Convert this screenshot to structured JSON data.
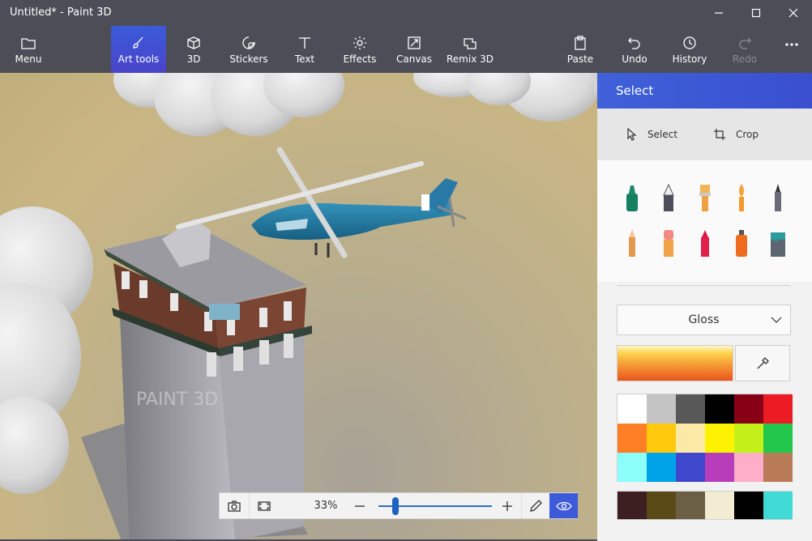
{
  "window": {
    "title": "Untitled* - Paint 3D"
  },
  "toolbar": {
    "items": [
      {
        "label": "Menu",
        "icon": "folder-icon",
        "active": false
      },
      {
        "label": "Art tools",
        "icon": "brush-icon",
        "active": true
      },
      {
        "label": "3D",
        "icon": "cube-icon",
        "active": false
      },
      {
        "label": "Stickers",
        "icon": "sticker-icon",
        "active": false
      },
      {
        "label": "Text",
        "icon": "text-icon",
        "active": false
      },
      {
        "label": "Effects",
        "icon": "sun-icon",
        "active": false
      },
      {
        "label": "Canvas",
        "icon": "canvas-resize-icon",
        "active": false
      },
      {
        "label": "Remix 3D",
        "icon": "remix-icon",
        "active": false
      },
      {
        "label": "Paste",
        "icon": "clipboard-icon",
        "active": false
      },
      {
        "label": "Undo",
        "icon": "undo-icon",
        "active": false
      },
      {
        "label": "History",
        "icon": "history-icon",
        "active": false
      },
      {
        "label": "Redo",
        "icon": "redo-icon",
        "active": false,
        "disabled": true
      }
    ],
    "more": "more-icon"
  },
  "zoom": {
    "level_text": "33%",
    "slider_value": 0.15
  },
  "panel": {
    "title": "Select",
    "select_label": "Select",
    "crop_label": "Crop",
    "brushes": [
      {
        "name": "marker-brush",
        "color": "#1a8a6a"
      },
      {
        "name": "calligraphy-pen",
        "color": "#5a5a6a"
      },
      {
        "name": "oil-brush",
        "color": "#e9a24a"
      },
      {
        "name": "watercolor-brush",
        "color": "#f0a030"
      },
      {
        "name": "pixel-pen",
        "color": "#6a6a7a"
      },
      {
        "name": "pencil",
        "color": "#e0a060"
      },
      {
        "name": "eraser",
        "color": "#f08a80"
      },
      {
        "name": "crayon",
        "color": "#e0204a"
      },
      {
        "name": "spray-can",
        "color": "#f06a20"
      },
      {
        "name": "fill-bucket",
        "color": "#2a9a9a"
      }
    ],
    "texture": "Gloss",
    "current_color": "#f27a2a",
    "palette": [
      "#ffffff",
      "#c3c3c3",
      "#585858",
      "#000000",
      "#880015",
      "#ed1c24",
      "#ff7f27",
      "#ffc90e",
      "#fce9a5",
      "#fff200",
      "#c4f019",
      "#22c74c",
      "#8cfffb",
      "#00a2e8",
      "#3f48cc",
      "#b83dba",
      "#ffaec9",
      "#b97a57"
    ],
    "custom_colors": [
      "#3d1f22",
      "#5a4a18",
      "#6b5f45",
      "#f3ecd2",
      "#000000",
      "#3fd9d6"
    ]
  }
}
